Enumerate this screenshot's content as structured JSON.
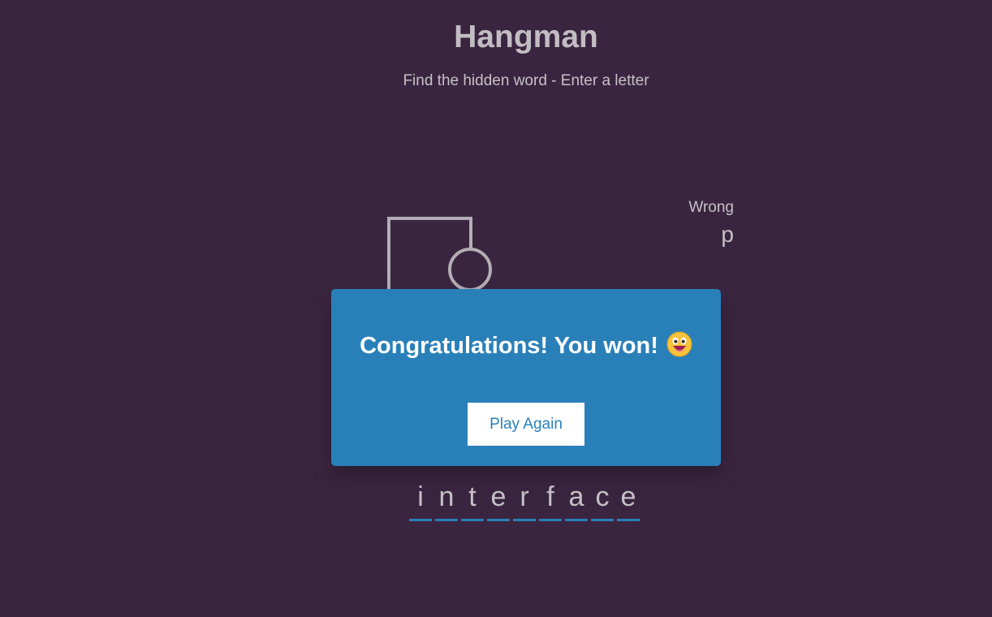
{
  "header": {
    "title": "Hangman",
    "subtitle": "Find the hidden word - Enter a letter"
  },
  "wrong": {
    "label": "Wrong",
    "letters": "p"
  },
  "word": {
    "letters": [
      "i",
      "n",
      "t",
      "e",
      "r",
      "f",
      "a",
      "c",
      "e"
    ]
  },
  "popup": {
    "message": "Congratulations! You won!",
    "emoji_icon": "grinning-face-icon",
    "button_label": "Play Again"
  },
  "colors": {
    "background": "#3a2540",
    "accent": "#2980b9",
    "text": "#c6c1c6"
  }
}
